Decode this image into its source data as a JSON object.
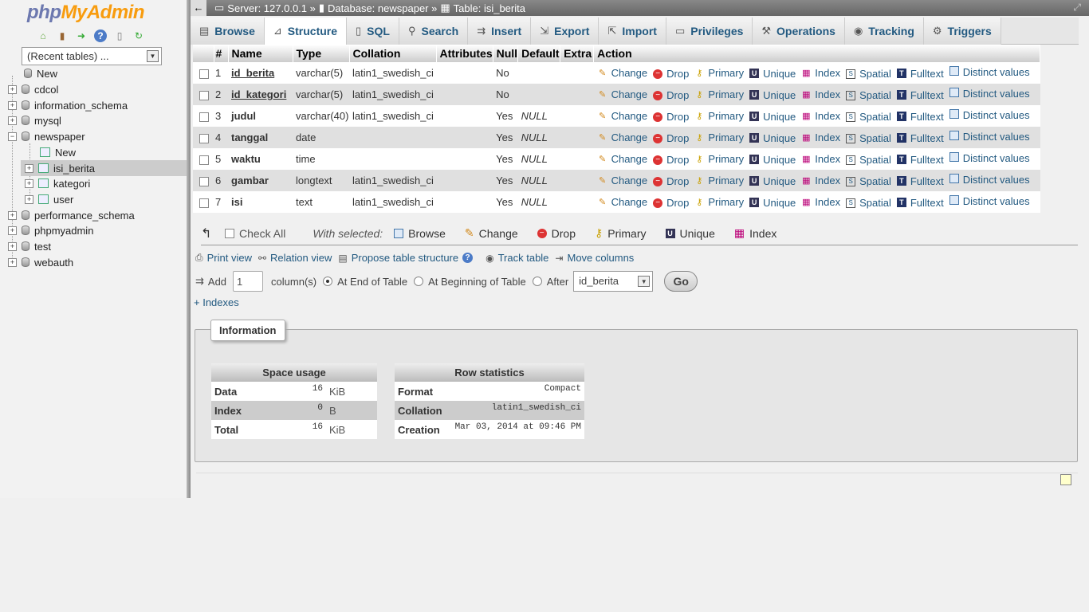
{
  "sidebar": {
    "logo_php": "php",
    "logo_myadmin": "MyAdmin",
    "recent": "(Recent tables) ...",
    "tree": {
      "new": "New",
      "dbs": [
        "cdcol",
        "information_schema",
        "mysql",
        "newspaper",
        "performance_schema",
        "phpmyadmin",
        "test",
        "webauth"
      ],
      "newspaper_children": [
        "New",
        "isi_berita",
        "kategori",
        "user"
      ]
    }
  },
  "topbar": {
    "server": "Server: 127.0.0.1 »",
    "database": "Database: newspaper »",
    "table": "Table: isi_berita"
  },
  "tabs": [
    "Browse",
    "Structure",
    "SQL",
    "Search",
    "Insert",
    "Export",
    "Import",
    "Privileges",
    "Operations",
    "Tracking",
    "Triggers"
  ],
  "active_tab": "Structure",
  "structure": {
    "headers": [
      "#",
      "Name",
      "Type",
      "Collation",
      "Attributes",
      "Null",
      "Default",
      "Extra",
      "Action"
    ],
    "rows": [
      {
        "n": "1",
        "name": "id_berita",
        "type": "varchar(5)",
        "collation": "latin1_swedish_ci",
        "null": "No",
        "default": ""
      },
      {
        "n": "2",
        "name": "id_kategori",
        "type": "varchar(5)",
        "collation": "latin1_swedish_ci",
        "null": "No",
        "default": ""
      },
      {
        "n": "3",
        "name": "judul",
        "type": "varchar(40)",
        "collation": "latin1_swedish_ci",
        "null": "Yes",
        "default": "NULL"
      },
      {
        "n": "4",
        "name": "tanggal",
        "type": "date",
        "collation": "",
        "null": "Yes",
        "default": "NULL"
      },
      {
        "n": "5",
        "name": "waktu",
        "type": "time",
        "collation": "",
        "null": "Yes",
        "default": "NULL"
      },
      {
        "n": "6",
        "name": "gambar",
        "type": "longtext",
        "collation": "latin1_swedish_ci",
        "null": "Yes",
        "default": "NULL"
      },
      {
        "n": "7",
        "name": "isi",
        "type": "text",
        "collation": "latin1_swedish_ci",
        "null": "Yes",
        "default": "NULL"
      }
    ],
    "actions": [
      "Change",
      "Drop",
      "Primary",
      "Unique",
      "Index",
      "Spatial",
      "Fulltext",
      "Distinct values"
    ]
  },
  "with_selected": {
    "check_all": "Check All",
    "label": "With selected:",
    "items": [
      "Browse",
      "Change",
      "Drop",
      "Primary",
      "Unique",
      "Index"
    ]
  },
  "links": [
    "Print view",
    "Relation view",
    "Propose table structure",
    "Track table",
    "Move columns"
  ],
  "add": {
    "label": "Add",
    "count": "1",
    "columns": "column(s)",
    "at_end": "At End of Table",
    "at_begin": "At Beginning of Table",
    "after": "After",
    "after_value": "id_berita",
    "go": "Go"
  },
  "indexes_link": "+ Indexes",
  "information": {
    "legend": "Information",
    "space_usage": {
      "title": "Space usage",
      "rows": [
        {
          "label": "Data",
          "value": "16",
          "unit": "KiB"
        },
        {
          "label": "Index",
          "value": "0",
          "unit": "B"
        },
        {
          "label": "Total",
          "value": "16",
          "unit": "KiB"
        }
      ]
    },
    "row_statistics": {
      "title": "Row statistics",
      "rows": [
        {
          "label": "Format",
          "value": "Compact"
        },
        {
          "label": "Collation",
          "value": "latin1_swedish_ci"
        },
        {
          "label": "Creation",
          "value": "Mar 03, 2014 at 09:46 PM"
        }
      ]
    }
  }
}
